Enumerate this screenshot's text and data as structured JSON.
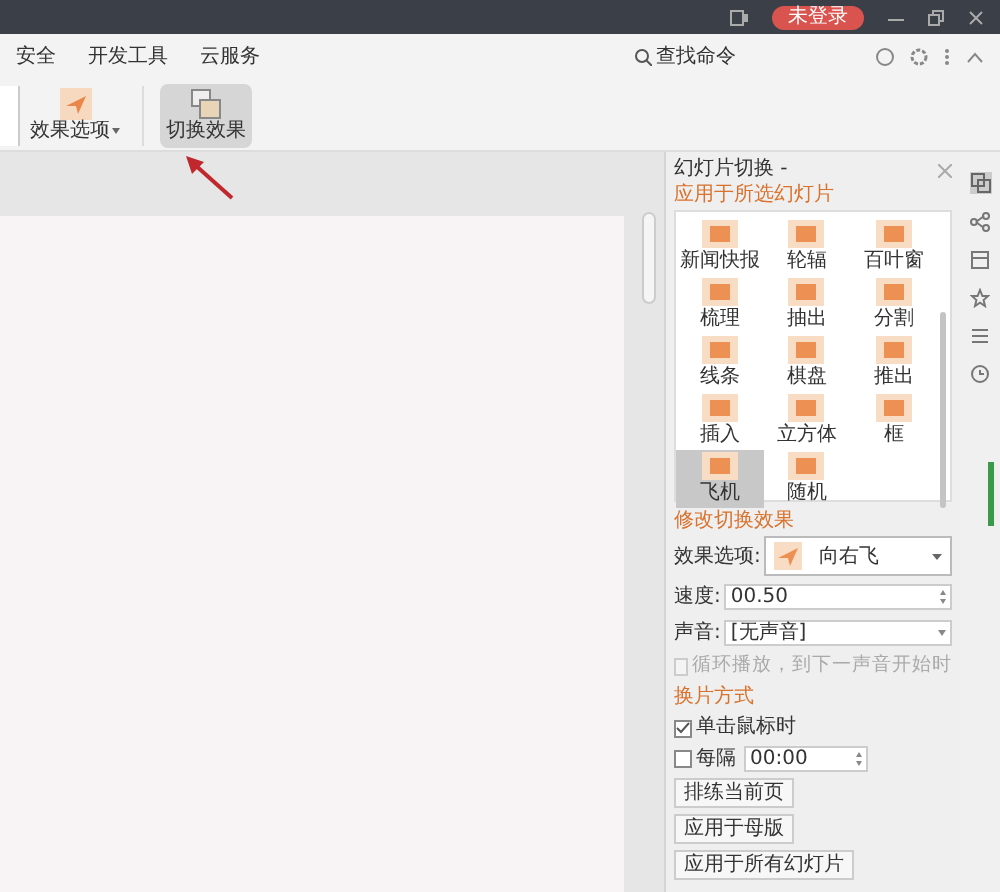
{
  "title_bar": {
    "login_badge": "未登录"
  },
  "menu": [
    {
      "label": "安全"
    },
    {
      "label": "开发工具"
    },
    {
      "label": "云服务"
    }
  ],
  "search": {
    "label": "查找命令"
  },
  "ribbon": [
    {
      "label": "效果选项",
      "kind": "dropdown",
      "selected": false
    },
    {
      "label": "切换效果",
      "kind": "button",
      "selected": true
    }
  ],
  "panel": {
    "title": "幻灯片切换 -",
    "apply_heading": "应用于所选幻灯片",
    "effects": [
      {
        "label": "新闻快报",
        "selected": false
      },
      {
        "label": "轮辐",
        "selected": false
      },
      {
        "label": "百叶窗",
        "selected": false
      },
      {
        "label": "梳理",
        "selected": false
      },
      {
        "label": "抽出",
        "selected": false
      },
      {
        "label": "分割",
        "selected": false
      },
      {
        "label": "线条",
        "selected": false
      },
      {
        "label": "棋盘",
        "selected": false
      },
      {
        "label": "推出",
        "selected": false
      },
      {
        "label": "插入",
        "selected": false
      },
      {
        "label": "立方体",
        "selected": false
      },
      {
        "label": "框",
        "selected": false
      },
      {
        "label": "飞机",
        "selected": true
      },
      {
        "label": "随机",
        "selected": false
      }
    ],
    "modify_heading": "修改切换效果",
    "effect_option": {
      "label": "效果选项:",
      "value": "向右飞"
    },
    "speed": {
      "label": "速度:",
      "value": "00.50"
    },
    "sound": {
      "label": "声音:",
      "value": "[无声音]"
    },
    "loop": {
      "label": "循环播放，到下一声音开始时",
      "checked": false,
      "disabled": true
    },
    "advance_heading": "换片方式",
    "on_click": {
      "label": "单击鼠标时",
      "checked": true
    },
    "every": {
      "label": "每隔",
      "checked": false,
      "value": "00:00"
    },
    "buttons": [
      "排练当前页",
      "应用于母版",
      "应用于所有幻灯片"
    ]
  }
}
